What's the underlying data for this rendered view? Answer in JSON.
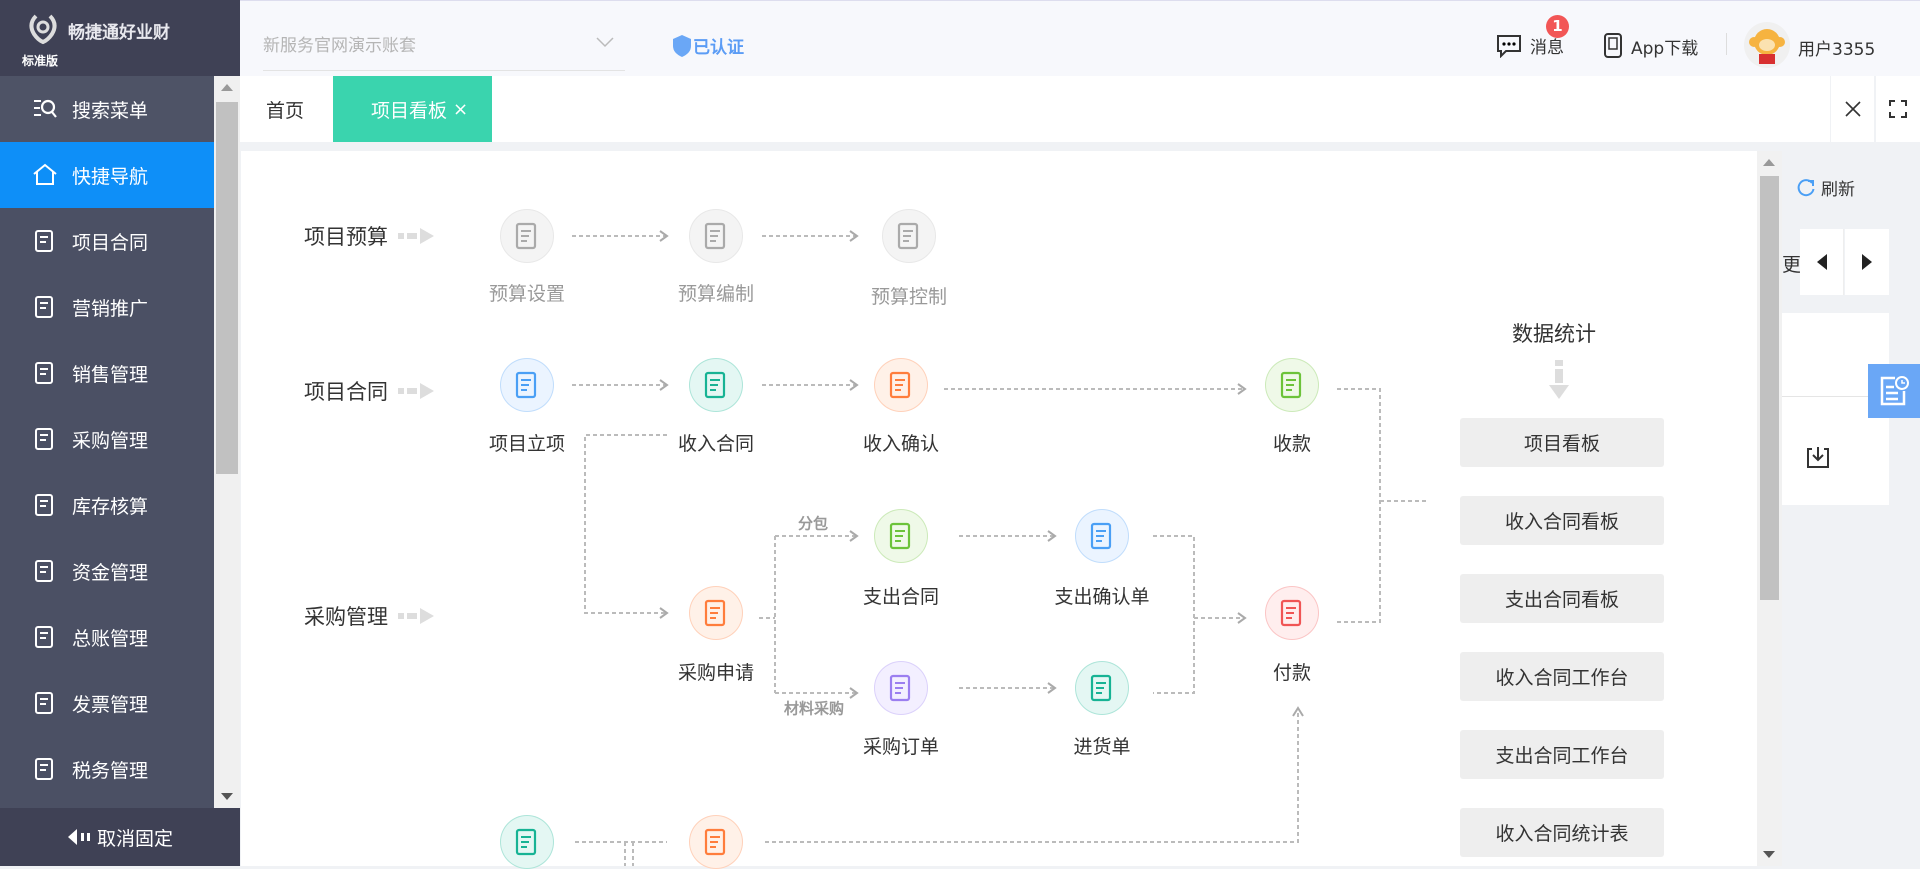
{
  "brand": {
    "name": "畅捷通好业财",
    "edition": "标准版"
  },
  "header": {
    "account_select": "新服务官网演示账套",
    "verified": "已认证",
    "messages": "消息",
    "message_badge": "1",
    "app_download": "App下载",
    "user": "用户3355"
  },
  "sidebar": {
    "items": [
      {
        "label": "搜索菜单",
        "icon": "search-menu-icon"
      },
      {
        "label": "快捷导航",
        "icon": "home-icon",
        "active": true
      },
      {
        "label": "项目合同",
        "icon": "contract-icon"
      },
      {
        "label": "营销推广",
        "icon": "gift-icon"
      },
      {
        "label": "销售管理",
        "icon": "sales-icon"
      },
      {
        "label": "采购管理",
        "icon": "bag-icon"
      },
      {
        "label": "库存核算",
        "icon": "warehouse-icon"
      },
      {
        "label": "资金管理",
        "icon": "money-bag-icon"
      },
      {
        "label": "总账管理",
        "icon": "ledger-icon"
      },
      {
        "label": "发票管理",
        "icon": "invoice-icon"
      },
      {
        "label": "税务管理",
        "icon": "tax-icon"
      }
    ],
    "unpin": "取消固定"
  },
  "tabs": [
    {
      "label": "首页"
    },
    {
      "label": "项目看板",
      "active": true,
      "close": "×"
    }
  ],
  "right_panel": {
    "refresh": "刷新",
    "more_partial": "更"
  },
  "flow": {
    "rows": [
      "项目预算",
      "项目合同",
      "采购管理"
    ],
    "nodes": [
      {
        "label": "预算设置",
        "color": "#aaaaaa",
        "bg": "#f4f4f4",
        "disabled": true
      },
      {
        "label": "预算编制",
        "color": "#aaaaaa",
        "bg": "#f4f4f4",
        "disabled": true
      },
      {
        "label": "预算控制",
        "color": "#aaaaaa",
        "bg": "#f4f4f4",
        "disabled": true
      },
      {
        "label": "项目立项",
        "color": "#4a9ff5",
        "bg": "#ebf4ff"
      },
      {
        "label": "收入合同",
        "color": "#17b394",
        "bg": "#e4f7f3"
      },
      {
        "label": "收入确认",
        "color": "#ff7d3c",
        "bg": "#fff1e8"
      },
      {
        "label": "收款",
        "color": "#6cc33a",
        "bg": "#eff9e8"
      },
      {
        "label": "支出合同",
        "color": "#6cc33a",
        "bg": "#eff9e8"
      },
      {
        "label": "支出确认单",
        "color": "#4a9ff5",
        "bg": "#ebf4ff"
      },
      {
        "label": "采购申请",
        "color": "#ff7d3c",
        "bg": "#fff1e8"
      },
      {
        "label": "付款",
        "color": "#f05555",
        "bg": "#ffeeee"
      },
      {
        "label": "采购订单",
        "color": "#9b7ef0",
        "bg": "#f3efff"
      },
      {
        "label": "进货单",
        "color": "#17b394",
        "bg": "#e4f7f3"
      },
      {
        "label": "",
        "color": "#17b394",
        "bg": "#e4f7f3"
      },
      {
        "label": "",
        "color": "#ff7d3c",
        "bg": "#fff1e8"
      }
    ],
    "branch_labels": [
      "分包",
      "材料采购"
    ]
  },
  "stats": {
    "title": "数据统计",
    "buttons": [
      "项目看板",
      "收入合同看板",
      "支出合同看板",
      "收入合同工作台",
      "支出合同工作台",
      "收入合同统计表"
    ]
  },
  "colors": {
    "accent": "#0e8ff8",
    "tab_active": "#3ad4ae",
    "sidebar": "#4b5064"
  }
}
